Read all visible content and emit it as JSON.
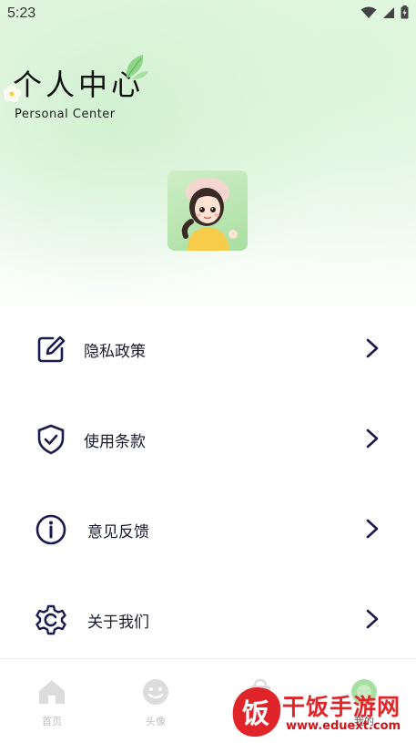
{
  "status_bar": {
    "time": "5:23"
  },
  "header": {
    "title": "个人中心",
    "subtitle": "Personal Center"
  },
  "menu": {
    "items": [
      {
        "label": "隐私政策",
        "icon": "edit-icon"
      },
      {
        "label": "使用条款",
        "icon": "shield-check-icon"
      },
      {
        "label": "意见反馈",
        "icon": "info-icon"
      },
      {
        "label": "关于我们",
        "icon": "gear-icon"
      }
    ]
  },
  "tabbar": {
    "tabs": [
      {
        "label": "首页",
        "icon": "home-icon"
      },
      {
        "label": "头像",
        "icon": "face-icon"
      },
      {
        "label": "",
        "icon": "bag-icon"
      },
      {
        "label": "我的",
        "icon": "profile-icon",
        "active": true
      }
    ]
  },
  "watermark": {
    "brand": "干饭手游网",
    "url": "www.eduext.com",
    "logo_char": "饭"
  },
  "colors": {
    "accent": "#1a1a4e",
    "bg_green": "#e6f6e3",
    "watermark_red": "#e0252a"
  }
}
